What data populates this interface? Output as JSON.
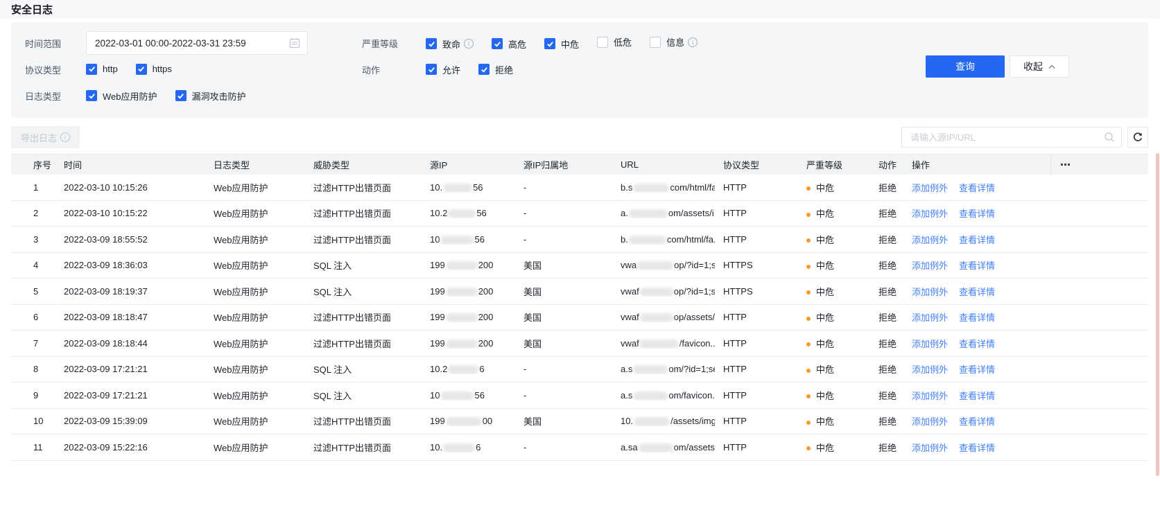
{
  "page": {
    "title": "安全日志"
  },
  "colors": {
    "accent": "#2468F2",
    "link": "#4080FF",
    "severity_medium_dot": "#FF9626"
  },
  "filters": {
    "time_range": {
      "label": "时间范围",
      "value": "2022-03-01 00:00-2022-03-31 23:59"
    },
    "severity": {
      "label": "严重等级",
      "options": [
        {
          "label": "致命",
          "checked": true,
          "info": true
        },
        {
          "label": "高危",
          "checked": true,
          "info": false
        },
        {
          "label": "中危",
          "checked": true,
          "info": false
        },
        {
          "label": "低危",
          "checked": false,
          "info": false
        },
        {
          "label": "信息",
          "checked": false,
          "info": true
        }
      ]
    },
    "protocol": {
      "label": "协议类型",
      "options": [
        {
          "label": "http",
          "checked": true,
          "info": false
        },
        {
          "label": "https",
          "checked": true,
          "info": false
        }
      ]
    },
    "action": {
      "label": "动作",
      "options": [
        {
          "label": "允许",
          "checked": true,
          "info": false
        },
        {
          "label": "拒绝",
          "checked": true,
          "info": false
        }
      ]
    },
    "log_type": {
      "label": "日志类型",
      "options": [
        {
          "label": "Web应用防护",
          "checked": true,
          "info": false
        },
        {
          "label": "漏洞攻击防护",
          "checked": true,
          "info": false
        }
      ]
    },
    "query_button": "查询",
    "collapse_button": "收起"
  },
  "toolbar": {
    "export_button": "导出日志",
    "search_placeholder": "请输入源IP/URL"
  },
  "table": {
    "columns": [
      "序号",
      "时间",
      "日志类型",
      "威胁类型",
      "源IP",
      "源IP归属地",
      "URL",
      "协议类型",
      "严重等级",
      "动作",
      "操作"
    ],
    "row_actions": [
      "添加例外",
      "查看详情"
    ],
    "rows": [
      {
        "seq": "1",
        "time": "2022-03-10 10:15:26",
        "log_type": "Web应用防护",
        "threat": "过滤HTTP出错页面",
        "ip_pre": "10.",
        "ip_post": "56",
        "ip_w": 42,
        "location": "-",
        "url_pre": "b.s",
        "url_post": "com/html/fa...",
        "url_w": 52,
        "protocol": "HTTP",
        "severity": "中危",
        "action": "拒绝"
      },
      {
        "seq": "2",
        "time": "2022-03-10 10:15:22",
        "log_type": "Web应用防护",
        "threat": "过滤HTTP出错页面",
        "ip_pre": "10.2",
        "ip_post": "56",
        "ip_w": 40,
        "location": "-",
        "url_pre": "a.",
        "url_post": "om/assets/i...",
        "url_w": 56,
        "protocol": "HTTP",
        "severity": "中危",
        "action": "拒绝"
      },
      {
        "seq": "3",
        "time": "2022-03-09 18:55:52",
        "log_type": "Web应用防护",
        "threat": "过滤HTTP出错页面",
        "ip_pre": "10",
        "ip_post": "56",
        "ip_w": 48,
        "location": "-",
        "url_pre": "b.",
        "url_post": "com/html/fa...",
        "url_w": 54,
        "protocol": "HTTP",
        "severity": "中危",
        "action": "拒绝"
      },
      {
        "seq": "4",
        "time": "2022-03-09 18:36:03",
        "log_type": "Web应用防护",
        "threat": "SQL 注入",
        "ip_pre": "199",
        "ip_post": "200",
        "ip_w": 46,
        "location": "美国",
        "url_pre": "vwa",
        "url_post": "op/?id=1;s...",
        "url_w": 52,
        "protocol": "HTTPS",
        "severity": "中危",
        "action": "拒绝"
      },
      {
        "seq": "5",
        "time": "2022-03-09 18:19:37",
        "log_type": "Web应用防护",
        "threat": "SQL 注入",
        "ip_pre": "199",
        "ip_post": "200",
        "ip_w": 46,
        "location": "美国",
        "url_pre": "vwaf",
        "url_post": "op/?id=1;s...",
        "url_w": 48,
        "protocol": "HTTPS",
        "severity": "中危",
        "action": "拒绝"
      },
      {
        "seq": "6",
        "time": "2022-03-09 18:18:47",
        "log_type": "Web应用防护",
        "threat": "过滤HTTP出错页面",
        "ip_pre": "199",
        "ip_post": "200",
        "ip_w": 46,
        "location": "美国",
        "url_pre": "vwaf",
        "url_post": "op/assets/i...",
        "url_w": 48,
        "protocol": "HTTP",
        "severity": "中危",
        "action": "拒绝"
      },
      {
        "seq": "7",
        "time": "2022-03-09 18:18:44",
        "log_type": "Web应用防护",
        "threat": "过滤HTTP出错页面",
        "ip_pre": "199",
        "ip_post": "200",
        "ip_w": 46,
        "location": "美国",
        "url_pre": "vwaf",
        "url_post": "/favicon...",
        "url_w": 56,
        "protocol": "HTTP",
        "severity": "中危",
        "action": "拒绝"
      },
      {
        "seq": "8",
        "time": "2022-03-09 17:21:21",
        "log_type": "Web应用防护",
        "threat": "SQL 注入",
        "ip_pre": "10.2",
        "ip_post": "6",
        "ip_w": 44,
        "location": "-",
        "url_pre": "a.s",
        "url_post": "om/?id=1;se...",
        "url_w": 50,
        "protocol": "HTTP",
        "severity": "中危",
        "action": "拒绝"
      },
      {
        "seq": "9",
        "time": "2022-03-09 17:21:21",
        "log_type": "Web应用防护",
        "threat": "SQL 注入",
        "ip_pre": "10",
        "ip_post": "56",
        "ip_w": 48,
        "location": "-",
        "url_pre": "a.s",
        "url_post": "om/favicon.i...",
        "url_w": 50,
        "protocol": "HTTP",
        "severity": "中危",
        "action": "拒绝"
      },
      {
        "seq": "10",
        "time": "2022-03-09 15:39:09",
        "log_type": "Web应用防护",
        "threat": "过滤HTTP出错页面",
        "ip_pre": "199",
        "ip_post": "00",
        "ip_w": 52,
        "location": "美国",
        "url_pre": "10.",
        "url_post": "/assets/img...",
        "url_w": 52,
        "protocol": "HTTP",
        "severity": "中危",
        "action": "拒绝"
      },
      {
        "seq": "11",
        "time": "2022-03-09 15:22:16",
        "log_type": "Web应用防护",
        "threat": "过滤HTTP出错页面",
        "ip_pre": "10.",
        "ip_post": "6",
        "ip_w": 46,
        "location": "-",
        "url_pre": "a.sa",
        "url_post": "om/assets/i...",
        "url_w": 50,
        "protocol": "HTTP",
        "severity": "中危",
        "action": "拒绝"
      }
    ]
  }
}
